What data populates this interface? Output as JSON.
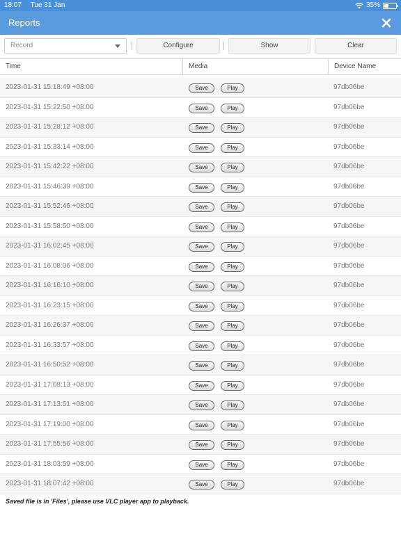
{
  "status_bar": {
    "time": "18:07",
    "date": "Tue 31 Jan",
    "battery": "35%",
    "battery_level": 0.35
  },
  "header": {
    "title": "Reports"
  },
  "toolbar": {
    "select_value": "Record",
    "configure_label": "Configure",
    "show_label": "Show",
    "clear_label": "Clear"
  },
  "table": {
    "columns": {
      "time": "Time",
      "media": "Media",
      "device": "Device Name"
    },
    "save_label": "Save",
    "play_label": "Play",
    "rows": [
      {
        "time": "2023-01-31 15:18:49 +08:00",
        "device": "97db06be"
      },
      {
        "time": "2023-01-31 15:22:50 +08:00",
        "device": "97db06be"
      },
      {
        "time": "2023-01-31 15:28:12 +08:00",
        "device": "97db06be"
      },
      {
        "time": "2023-01-31 15:33:14 +08:00",
        "device": "97db06be"
      },
      {
        "time": "2023-01-31 15:42:22 +08:00",
        "device": "97db06be"
      },
      {
        "time": "2023-01-31 15:46:39 +08:00",
        "device": "97db06be"
      },
      {
        "time": "2023-01-31 15:52:46 +08:00",
        "device": "97db06be"
      },
      {
        "time": "2023-01-31 15:58:50 +08:00",
        "device": "97db06be"
      },
      {
        "time": "2023-01-31 16:02:45 +08:00",
        "device": "97db06be"
      },
      {
        "time": "2023-01-31 16:08:06 +08:00",
        "device": "97db06be"
      },
      {
        "time": "2023-01-31 16:16:10 +08:00",
        "device": "97db06be"
      },
      {
        "time": "2023-01-31 16:23:15 +08:00",
        "device": "97db06be"
      },
      {
        "time": "2023-01-31 16:26:37 +08:00",
        "device": "97db06be"
      },
      {
        "time": "2023-01-31 16:33:57 +08:00",
        "device": "97db06be"
      },
      {
        "time": "2023-01-31 16:50:52 +08:00",
        "device": "97db06be"
      },
      {
        "time": "2023-01-31 17:08:13 +08:00",
        "device": "97db06be"
      },
      {
        "time": "2023-01-31 17:13:51 +08:00",
        "device": "97db06be"
      },
      {
        "time": "2023-01-31 17:19:00 +08:00",
        "device": "97db06be"
      },
      {
        "time": "2023-01-31 17:55:56 +08:00",
        "device": "97db06be"
      },
      {
        "time": "2023-01-31 18:03:59 +08:00",
        "device": "97db06be"
      },
      {
        "time": "2023-01-31 18:07:42 +08:00",
        "device": "97db06be"
      }
    ]
  },
  "footer": {
    "note": "Saved file is in 'Files', please use VLC player app to playback."
  },
  "icons": {
    "close": "close-icon",
    "wifi": "wifi-icon",
    "battery": "battery-icon",
    "dropdown": "chevron-down-icon"
  },
  "colors": {
    "status_bar": "#4a90d9",
    "title_bar": "#5a9be0",
    "title_text": "#ffffff"
  }
}
